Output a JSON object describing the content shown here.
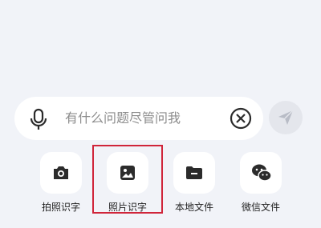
{
  "input": {
    "placeholder": "有什么问题尽管问我"
  },
  "tools": [
    {
      "label": "拍照识字",
      "icon": "camera-icon"
    },
    {
      "label": "照片识字",
      "icon": "image-icon"
    },
    {
      "label": "本地文件",
      "icon": "folder-icon"
    },
    {
      "label": "微信文件",
      "icon": "wechat-icon"
    }
  ],
  "colors": {
    "highlight": "#d0253a",
    "background": "#f1f3f8",
    "icon": "#2b2b2b"
  }
}
